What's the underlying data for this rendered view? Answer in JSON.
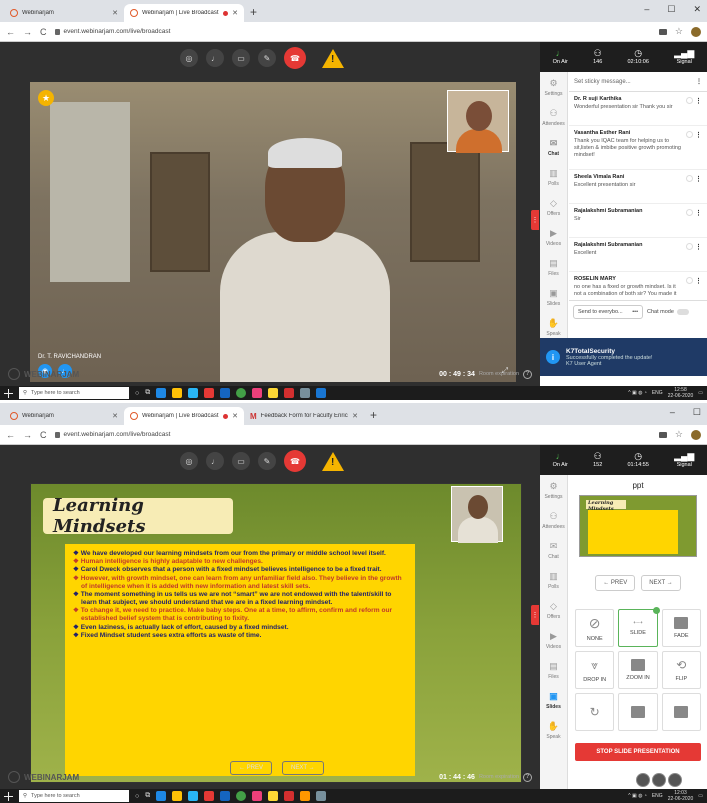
{
  "top": {
    "tabs": [
      {
        "title": "Webinarjam"
      },
      {
        "title": "Webinarjam | Live Broadcast"
      }
    ],
    "url": "event.webinarjam.com/live/broadcast",
    "controls": {
      "warn": "!"
    },
    "presenter_name": "Dr. T. RAVICHANDRAN",
    "logo": "WEBINARJAM",
    "timer": "00 : 49 : 34",
    "timer_label": "Room expiration",
    "side_stats": [
      {
        "label": "On Air",
        "icon": "mic"
      },
      {
        "label": "146",
        "icon": "people"
      },
      {
        "label": "02:10:06",
        "icon": "clock"
      },
      {
        "label": "Signal",
        "icon": "signal"
      }
    ],
    "rail": [
      "Settings",
      "Attendees",
      "Chat",
      "Polls",
      "Offers",
      "Videos",
      "Files",
      "Slides",
      "Speak"
    ],
    "sticky_placeholder": "Set sticky message...",
    "messages": [
      {
        "name": "Dr. R suji Karthika",
        "text": "Wonderful presentation sir Thank you sir"
      },
      {
        "name": "Vasantha Esther Rani",
        "text": "Thank you IQAC team for helping us to sit,listen & imbibe positive growth promoting mindset!"
      },
      {
        "name": "Sheela Vimala Rani",
        "text": "Excellent presentation sir"
      },
      {
        "name": "Rajalakshmi Subramanian",
        "text": "Sir"
      },
      {
        "name": "Rajalakshmi Subramanian",
        "text": "Excellent"
      },
      {
        "name": "ROSELIN MARY",
        "text": "no one has a fixed or growth mindset. Is it not a combination of both sir? You made it"
      }
    ],
    "send_to": "Send to everybo...",
    "send_dots": "•••",
    "chat_mode": "Chat mode",
    "toast": {
      "title": "K7TotalSecurity",
      "body": "Successfully completed the update!",
      "source": "K7 User Agent"
    },
    "taskbar": {
      "search": "Type here to search",
      "lang": "ENG",
      "time": "12:58",
      "date": "22-06-2020"
    }
  },
  "bottom": {
    "tabs": [
      {
        "title": "Webinarjam"
      },
      {
        "title": "Webinarjam | Live Broadcast"
      },
      {
        "title": "Feedback Form for Faculty Enrich"
      }
    ],
    "url": "event.webinarjam.com/live/broadcast",
    "slide_title": "Learning Mindsets",
    "bullets": [
      {
        "text": "We have developed our learning mindsets from our from the primary or middle school level itself.",
        "color": "blue"
      },
      {
        "text": "Human intelligence is highly adaptable to new challenges.",
        "color": "red"
      },
      {
        "text": "Carol Dweck observes that a person with a fixed mindset believes intelligence to be a fixed trait.",
        "color": "blue"
      },
      {
        "text": "However, with growth mindset, one can learn from any unfamiliar field also. They believe in the growth of intelligence when it is added with new information and latest skill sets.",
        "color": "red"
      },
      {
        "text": "The moment something in us tells us we are not “smart” we are not endowed with the talent/skill to learn that subject, we should understand that we are in a fixed learning mindset.",
        "color": "blue"
      },
      {
        "text": "To change it, we need to practice. Make baby steps. One at a time, to affirm, confirm and reform our established belief system that is contributing to fixity.",
        "color": "red"
      },
      {
        "text": "Even laziness, is actually lack of effort, caused by a fixed mindset.",
        "color": "blue"
      },
      {
        "text": "Fixed Mindset student sees extra efforts as waste of time.",
        "color": "blue"
      }
    ],
    "prev": "← PREV",
    "next": "NEXT →",
    "logo": "WEBINARJAM",
    "timer": "01 : 44 : 46",
    "timer_label": "Room expiration",
    "side_stats": [
      {
        "label": "On Air",
        "icon": "mic"
      },
      {
        "label": "152",
        "icon": "people"
      },
      {
        "label": "01:14:55",
        "icon": "clock"
      },
      {
        "label": "Signal",
        "icon": "signal"
      }
    ],
    "rail": [
      "Settings",
      "Attendees",
      "Chat",
      "Polls",
      "Offers",
      "Videos",
      "Files",
      "Slides",
      "Speak"
    ],
    "ppt_header": "ppt",
    "thumb_title": "Learning Mindsets",
    "ppt_prev": "← PREV",
    "ppt_next": "NEXT →",
    "effects": [
      "NONE",
      "SLIDE",
      "FADE",
      "DROP IN",
      "ZOOM IN",
      "FLIP",
      "",
      "",
      ""
    ],
    "stop": "STOP SLIDE PRESENTATION",
    "taskbar": {
      "search": "Type here to search",
      "lang": "ENG",
      "time": "12:03",
      "date": "22-06-2020"
    }
  }
}
